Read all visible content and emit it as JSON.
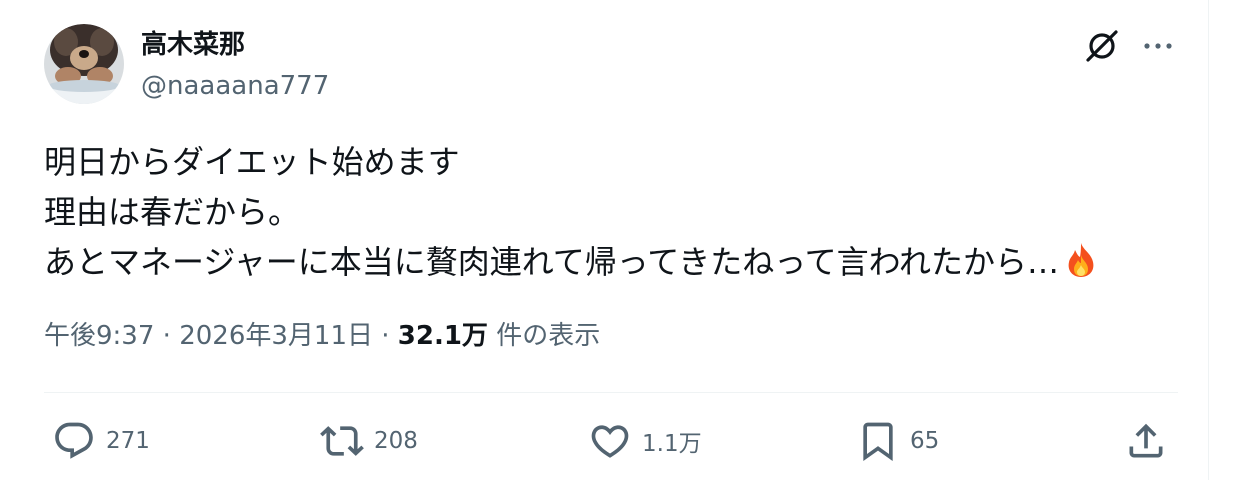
{
  "tweet": {
    "author_name": "高木菜那",
    "author_handle": "@naaaana777",
    "text_lines": [
      "明日からダイエット始めます",
      "理由は春だから。",
      "あとマネージャーに本当に贅肉連れて帰ってきたねって言われたから…"
    ],
    "emoji": "fire-icon",
    "time": "午後9:37",
    "separator": "·",
    "date": "2026年3月11日",
    "views_count": "32.1万",
    "views_label": "件の表示"
  },
  "actions": {
    "replies": "271",
    "reposts": "208",
    "likes": "1.1万",
    "bookmarks": "65"
  },
  "colors": {
    "text": "#0f1419",
    "secondary": "#536471",
    "divider": "#eff3f4"
  }
}
